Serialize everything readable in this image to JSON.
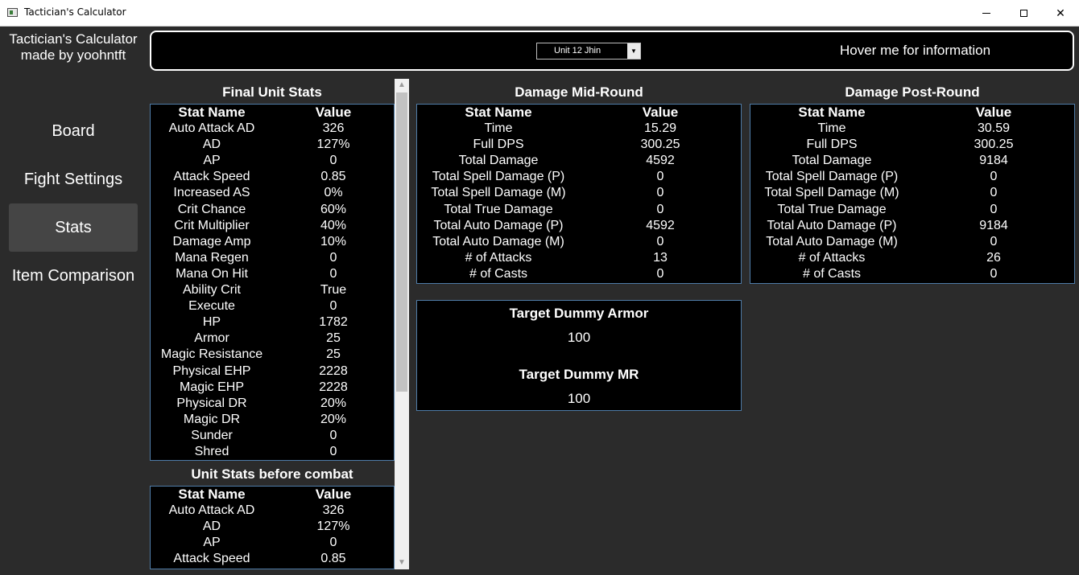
{
  "window": {
    "title": "Tactician's Calculator",
    "minimize_icon": "minimize-icon",
    "maximize_icon": "maximize-icon",
    "close_icon": "close-icon",
    "close_glyph": "✕"
  },
  "sidebar": {
    "brand_line1": "Tactician's Calculator",
    "brand_line2": "made by yoohntft",
    "items": [
      {
        "label": "Board",
        "active": false
      },
      {
        "label": "Fight Settings",
        "active": false
      },
      {
        "label": "Stats",
        "active": true
      },
      {
        "label": "Item Comparison",
        "active": false
      }
    ]
  },
  "top": {
    "unit_select_value": "Unit 12  Jhin",
    "hover_info": "Hover me for information"
  },
  "final_stats": {
    "title": "Final Unit Stats",
    "col1": "Stat Name",
    "col2": "Value",
    "rows": [
      [
        "Auto Attack AD",
        "326"
      ],
      [
        "AD",
        "127%"
      ],
      [
        "AP",
        "0"
      ],
      [
        "Attack Speed",
        "0.85"
      ],
      [
        "Increased AS",
        "0%"
      ],
      [
        "Crit Chance",
        "60%"
      ],
      [
        "Crit Multiplier",
        "40%"
      ],
      [
        "Damage Amp",
        "10%"
      ],
      [
        "Mana Regen",
        "0"
      ],
      [
        "Mana On Hit",
        "0"
      ],
      [
        "Ability Crit",
        "True"
      ],
      [
        "Execute",
        "0"
      ],
      [
        "HP",
        "1782"
      ],
      [
        "Armor",
        "25"
      ],
      [
        "Magic Resistance",
        "25"
      ],
      [
        "Physical EHP",
        "2228"
      ],
      [
        "Magic EHP",
        "2228"
      ],
      [
        "Physical DR",
        "20%"
      ],
      [
        "Magic DR",
        "20%"
      ],
      [
        "Sunder",
        "0"
      ],
      [
        "Shred",
        "0"
      ]
    ]
  },
  "before_combat": {
    "title": "Unit Stats before combat",
    "col1": "Stat Name",
    "col2": "Value",
    "rows": [
      [
        "Auto Attack AD",
        "326"
      ],
      [
        "AD",
        "127%"
      ],
      [
        "AP",
        "0"
      ],
      [
        "Attack Speed",
        "0.85"
      ]
    ]
  },
  "mid_round": {
    "title": "Damage Mid-Round",
    "col1": "Stat Name",
    "col2": "Value",
    "rows": [
      [
        "Time",
        "15.29"
      ],
      [
        "Full DPS",
        "300.25"
      ],
      [
        "Total Damage",
        "4592"
      ],
      [
        "Total Spell Damage (P)",
        "0"
      ],
      [
        "Total Spell Damage (M)",
        "0"
      ],
      [
        "Total True Damage",
        "0"
      ],
      [
        "Total Auto Damage (P)",
        "4592"
      ],
      [
        "Total Auto Damage (M)",
        "0"
      ],
      [
        "# of Attacks",
        "13"
      ],
      [
        "# of Casts",
        "0"
      ]
    ]
  },
  "post_round": {
    "title": "Damage Post-Round",
    "col1": "Stat Name",
    "col2": "Value",
    "rows": [
      [
        "Time",
        "30.59"
      ],
      [
        "Full DPS",
        "300.25"
      ],
      [
        "Total Damage",
        "9184"
      ],
      [
        "Total Spell Damage (P)",
        "0"
      ],
      [
        "Total Spell Damage (M)",
        "0"
      ],
      [
        "Total True Damage",
        "0"
      ],
      [
        "Total Auto Damage (P)",
        "9184"
      ],
      [
        "Total Auto Damage (M)",
        "0"
      ],
      [
        "# of Attacks",
        "26"
      ],
      [
        "# of Casts",
        "0"
      ]
    ]
  },
  "dummy": {
    "armor_label": "Target Dummy Armor",
    "armor_value": "100",
    "mr_label": "Target Dummy MR",
    "mr_value": "100"
  },
  "colors": {
    "background": "#2b2b2b",
    "panel": "#000000",
    "border": "#4f7ca8",
    "active_nav": "#454545"
  }
}
